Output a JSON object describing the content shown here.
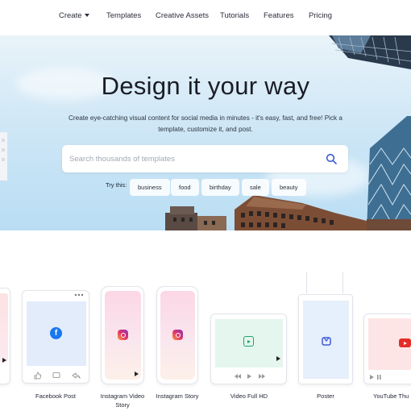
{
  "nav": {
    "items": [
      {
        "label": "Create",
        "has_caret": true
      },
      {
        "label": "Templates"
      },
      {
        "label": "Creative Assets"
      },
      {
        "label": "Tutorials"
      },
      {
        "label": "Features"
      },
      {
        "label": "Pricing"
      }
    ]
  },
  "hero": {
    "title": "Design it your way",
    "subtitle": "Create eye-catching visual content for social media in minutes - it's easy, fast, and free! Pick a template, customize it, and post.",
    "search_placeholder": "Search thousands of templates",
    "try_label": "Try this:",
    "chips": [
      "business",
      "food",
      "birthday",
      "sale",
      "beauty"
    ]
  },
  "templates": [
    {
      "label": ""
    },
    {
      "label": "Facebook Post",
      "icon": "facebook-icon"
    },
    {
      "label": "Instagram Video Story",
      "icon": "instagram-icon"
    },
    {
      "label": "Instagram Story",
      "icon": "instagram-icon"
    },
    {
      "label": "Video Full HD",
      "icon": "video-icon"
    },
    {
      "label": "Poster",
      "icon": "poster-icon"
    },
    {
      "label": "YouTube Thu",
      "icon": "youtube-icon"
    }
  ],
  "colors": {
    "accent": "#3d5bd9",
    "sky": "#cfe7f6",
    "facebook": "#1877f2",
    "youtube": "#e52d27"
  }
}
